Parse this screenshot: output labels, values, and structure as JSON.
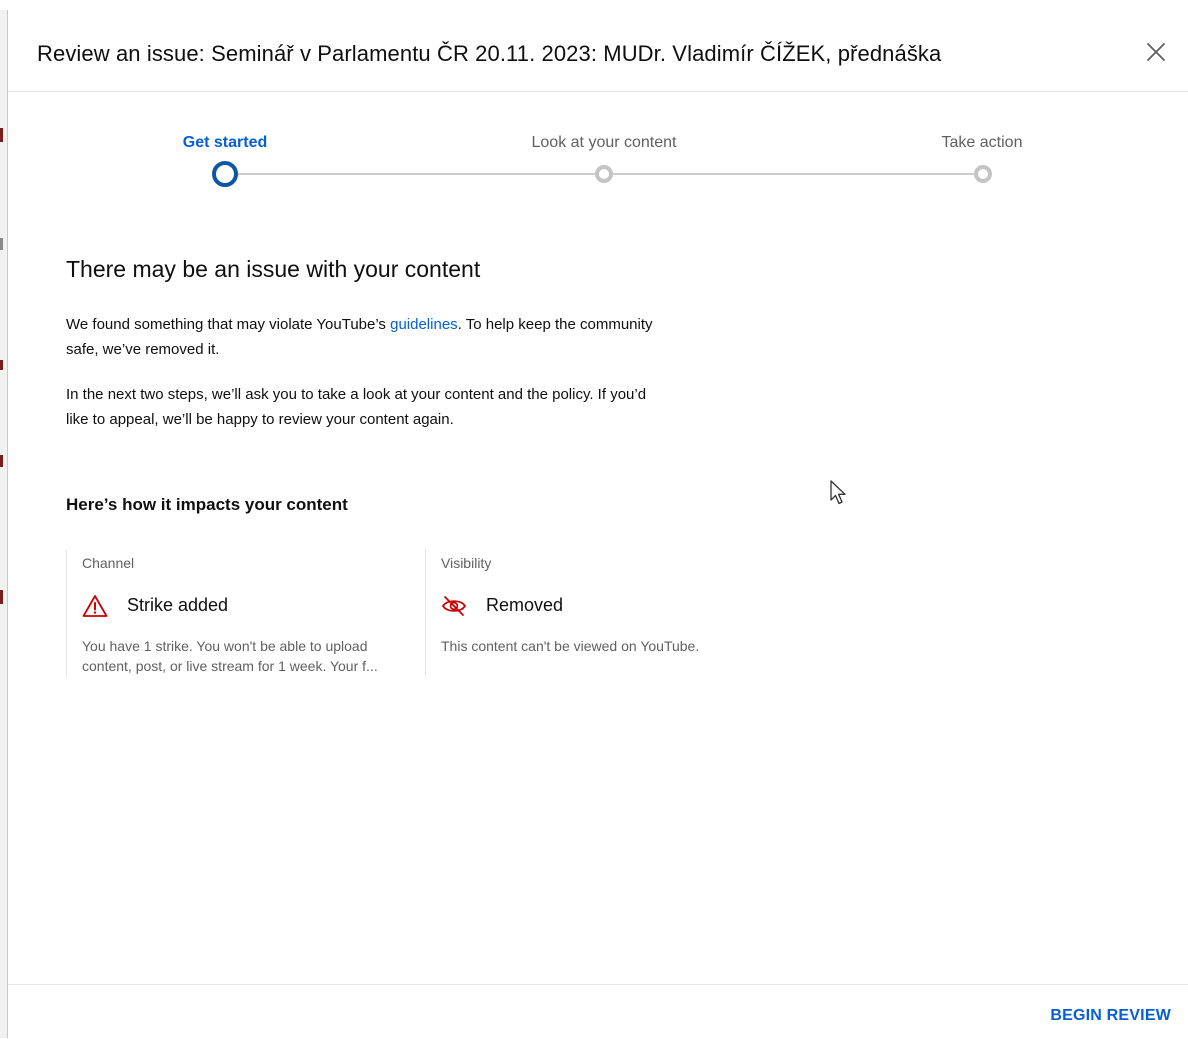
{
  "dialog": {
    "title": "Review an issue: Seminář v Parlamentu ČR 20.11. 2023: MUDr. Vladimír ČÍŽEK, přednáška",
    "close_icon": "close-icon"
  },
  "stepper": {
    "steps": [
      {
        "label": "Get started",
        "state": "active"
      },
      {
        "label": "Look at your content",
        "state": "inactive"
      },
      {
        "label": "Take action",
        "state": "inactive"
      }
    ]
  },
  "main": {
    "heading": "There may be an issue with your content",
    "para1_before": "We found something that may violate YouTube’s ",
    "para1_link": "guidelines",
    "para1_after": ". To help keep the community safe, we’ve removed it.",
    "para2": "In the next two steps, we’ll ask you to take a look at your content and the policy. If you’d like to appeal, we’ll be happy to review your content again.",
    "impact_heading": "Here’s how it impacts your content"
  },
  "impacts": [
    {
      "label": "Channel",
      "icon": "warning-triangle-icon",
      "status": "Strike added",
      "description": "You have 1 strike. You won't be able to upload content, post, or live stream for 1 week. Your f..."
    },
    {
      "label": "Visibility",
      "icon": "eye-off-icon",
      "status": "Removed",
      "description": "This content can't be viewed on YouTube."
    }
  ],
  "footer": {
    "begin_review": "BEGIN REVIEW"
  },
  "colors": {
    "accent": "#065fd4",
    "step_active": "#0b57a4",
    "warning": "#cc0000"
  }
}
